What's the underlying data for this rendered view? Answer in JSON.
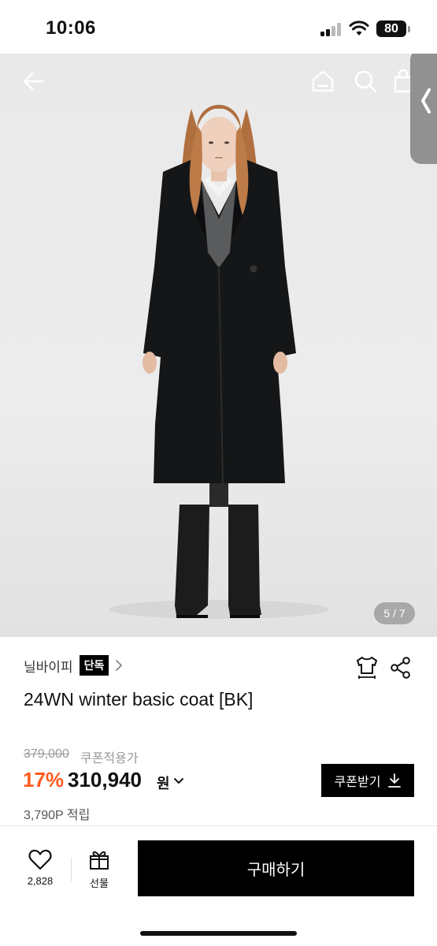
{
  "status_bar": {
    "time": "10:06",
    "battery": "80"
  },
  "gallery": {
    "page_indicator": "5 / 7",
    "nav_icons": [
      "back-arrow-icon",
      "home-icon",
      "search-icon",
      "cart-icon"
    ]
  },
  "product": {
    "brand": "닐바이피",
    "exclusive_badge": "단독",
    "title": "24WN winter basic coat [BK]",
    "original_price": "379,000",
    "coupon_price_label": "쿠폰적용가",
    "discount_rate": "17%",
    "sale_price": "310,940",
    "currency": "원",
    "coupon_button": "쿠폰받기",
    "points": "3,790P 적립"
  },
  "bottom_bar": {
    "like_count": "2,828",
    "gift_label": "선물",
    "buy_label": "구매하기"
  },
  "colors": {
    "accent_discount": "#ff5a1f",
    "primary_button": "#000000"
  }
}
